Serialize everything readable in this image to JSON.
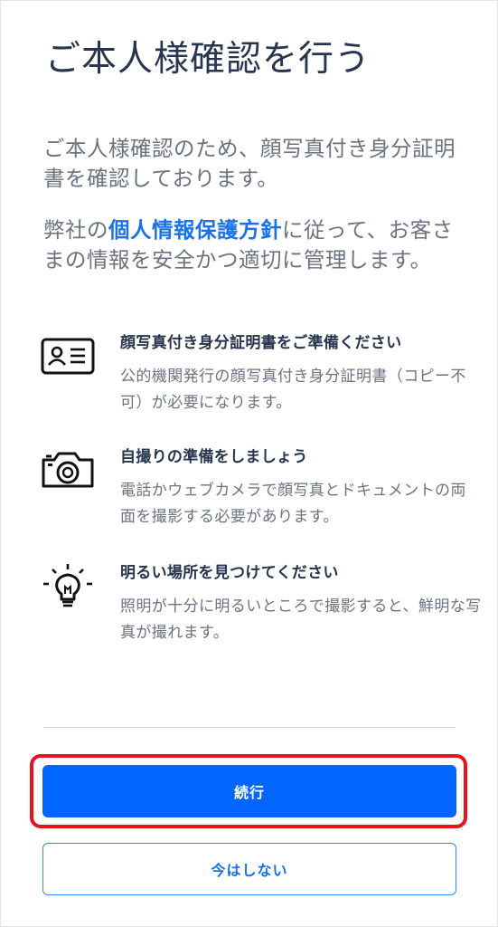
{
  "title": "ご本人様確認を行う",
  "intro": "ご本人様確認のため、顔写真付き身分証明書を確認しております。",
  "privacy": {
    "prefix": "弊社の",
    "link": "個人情報保護方針",
    "suffix": "に従って、お客さまの情報を安全かつ適切に管理します。"
  },
  "items": [
    {
      "icon": "id-card-icon",
      "heading": "顔写真付き身分証明書をご準備ください",
      "description": "公的機関発行の顔写真付き身分証明書（コピー不可）が必要になります。"
    },
    {
      "icon": "camera-icon",
      "heading": "自撮りの準備をしましょう",
      "description": "電話かウェブカメラで顔写真とドキュメントの両面を撮影する必要があります。"
    },
    {
      "icon": "lightbulb-icon",
      "heading": "明るい場所を見つけてください",
      "description": "照明が十分に明るいところで撮影すると、鮮明な写真が撮れます。"
    }
  ],
  "buttons": {
    "continue": "続行",
    "not_now": "今はしない"
  },
  "colors": {
    "primary": "#0066ff",
    "link": "#1a73e8",
    "highlight": "#e8141c"
  }
}
